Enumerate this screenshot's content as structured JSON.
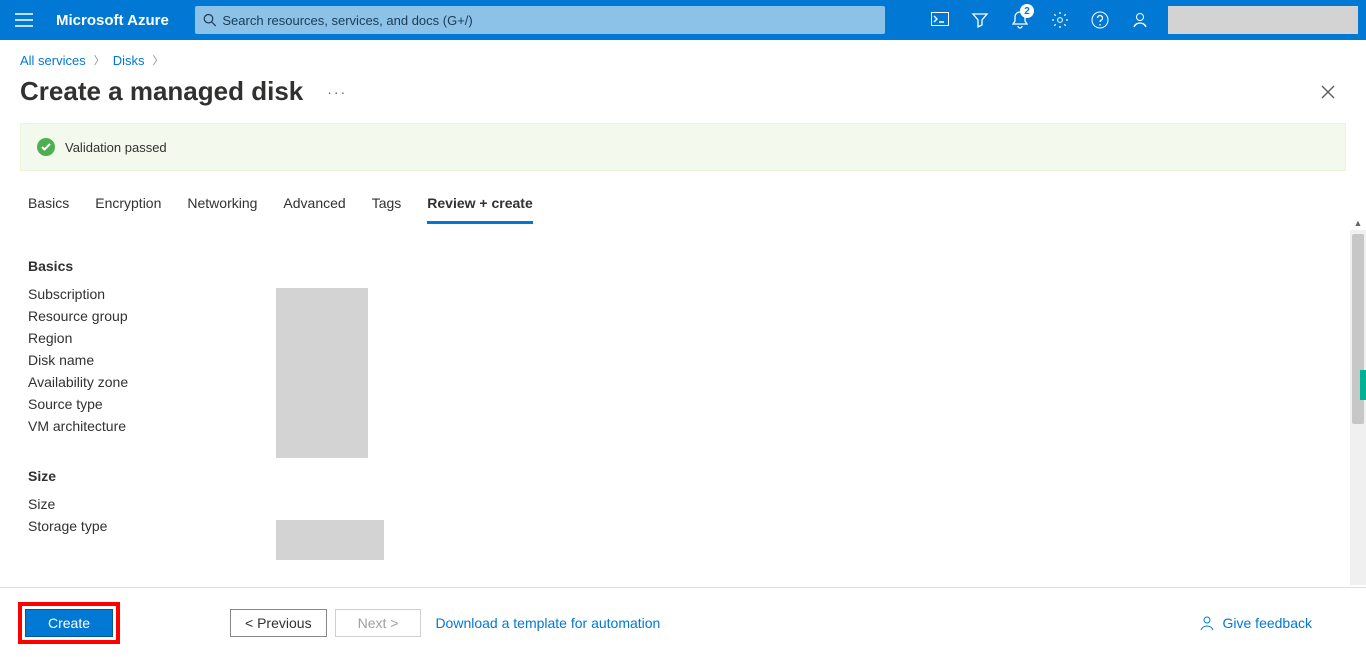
{
  "header": {
    "brand": "Microsoft Azure",
    "search_placeholder": "Search resources, services, and docs (G+/)",
    "notification_count": "2"
  },
  "breadcrumb": {
    "root": "All services",
    "current": "Disks"
  },
  "page": {
    "title": "Create a managed disk",
    "more": "···"
  },
  "validation": {
    "message": "Validation passed"
  },
  "tabs": {
    "basics": "Basics",
    "encryption": "Encryption",
    "networking": "Networking",
    "advanced": "Advanced",
    "tags": "Tags",
    "review": "Review + create"
  },
  "sections": {
    "basics": {
      "heading": "Basics",
      "rows": {
        "subscription": "Subscription",
        "resource_group": "Resource group",
        "region": "Region",
        "disk_name": "Disk name",
        "availability_zone": "Availability zone",
        "source_type": "Source type",
        "vm_architecture": "VM architecture"
      }
    },
    "size": {
      "heading": "Size",
      "rows": {
        "size": "Size",
        "storage_type": "Storage type"
      }
    }
  },
  "footer": {
    "create": "Create",
    "previous": "< Previous",
    "next": "Next >",
    "download": "Download a template for automation",
    "feedback": "Give feedback"
  }
}
